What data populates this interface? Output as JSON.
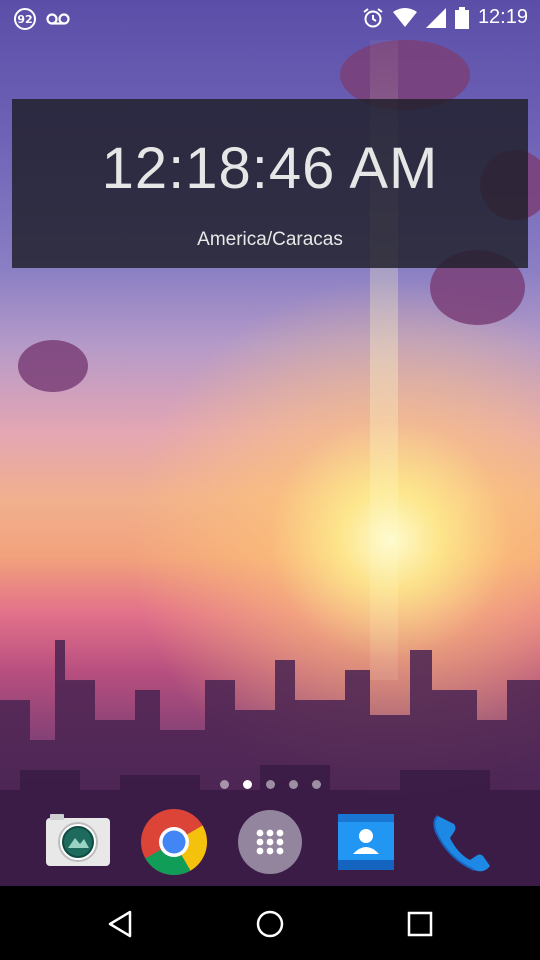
{
  "status_bar": {
    "notification_badge": "92",
    "left_icons": [
      "voicemail-icon"
    ],
    "right_icons": [
      "alarm-icon",
      "wifi-icon",
      "signal-icon",
      "battery-icon"
    ],
    "time": "12:19"
  },
  "clock_widget": {
    "time": "12:18:46 AM",
    "timezone": "America/Caracas"
  },
  "home_screen": {
    "page_indicator": {
      "pages": 5,
      "active_index": 1
    },
    "dock_apps": [
      {
        "name": "Camera",
        "icon": "camera-icon"
      },
      {
        "name": "Chrome",
        "icon": "chrome-icon"
      },
      {
        "name": "Apps",
        "icon": "app-drawer-icon"
      },
      {
        "name": "Contacts",
        "icon": "contacts-icon"
      },
      {
        "name": "Phone",
        "icon": "phone-icon"
      }
    ]
  },
  "navigation_bar": {
    "buttons": [
      "back-icon",
      "home-icon",
      "recents-icon"
    ]
  },
  "colors": {
    "widget_bg": "#1e1e28",
    "navbar_bg": "#000000",
    "chrome_red": "#db4437",
    "chrome_yellow": "#f4c20d",
    "chrome_green": "#0f9d58",
    "chrome_blue": "#4285f4",
    "phone_blue": "#1976d2",
    "contacts_blue": "#2196f3"
  }
}
